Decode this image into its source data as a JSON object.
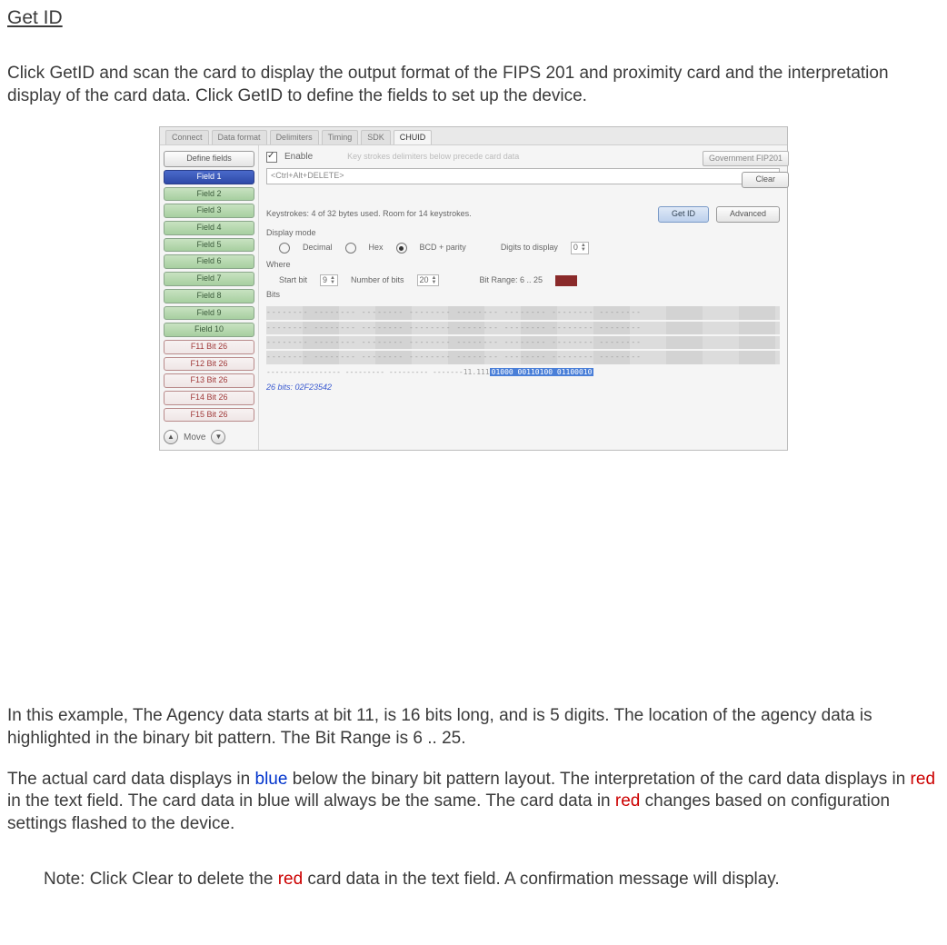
{
  "heading": "Get ID",
  "intro": "Click GetID and scan the card to display the output format of the FIPS 201 and proximity card and the interpretation display of the card data. Click GetID to define the fields to set up the device.",
  "para2_a": "In this example, The Agency data starts at bit 11, is 16 bits long, and is 5 digits. The location of the agency data is highlighted in the binary bit pattern. The Bit Range is 6 .. 25.",
  "para3_a": "The actual card data displays in ",
  "para3_blue": "blue",
  "para3_b": " below the binary bit pattern layout. The interpretation of the card data displays in ",
  "para3_red1": "red",
  "para3_c": " in the text field. The card data in blue will always be the same. The card data in ",
  "para3_red2": "red",
  "para3_d": " changes based on configuration settings flashed to the device.",
  "note_a": "Note: Click Clear to delete the ",
  "note_red": "red",
  "note_b": " card data in the text field. A confirmation message will display.",
  "shot": {
    "tabs": [
      "Connect",
      "Data format",
      "Delimiters",
      "Timing",
      "SDK",
      "CHUID"
    ],
    "define": "Define fields",
    "fields_green": [
      "Field 1",
      "Field 2",
      "Field 3",
      "Field 4",
      "Field 5",
      "Field 6",
      "Field 7",
      "Field 8",
      "Field 9",
      "Field 10"
    ],
    "fields_red": [
      "F11 Bit 26",
      "F12 Bit 26",
      "F13 Bit 26",
      "F14 Bit 26",
      "F15 Bit 26"
    ],
    "move": "Move",
    "enable": "Enable",
    "keyhint": "Key strokes delimiters below precede card data",
    "txtbox": "<Ctrl+Alt+DELETE>",
    "hangtab": "Government FIP201",
    "clear": "Clear",
    "kinfo": "Keystrokes: 4 of 32 bytes used. Room for 14 keystrokes.",
    "getid": "Get ID",
    "advanced": "Advanced",
    "displaymode": "Display mode",
    "decimal": "Decimal",
    "hex": "Hex",
    "bcd": "BCD + parity",
    "digits_lbl": "Digits to display",
    "digits_val": "0",
    "where": "Where",
    "startbit_lbl": "Start bit",
    "startbit_val": "9",
    "numbits_lbl": "Number of bits",
    "numbits_val": "20",
    "bitrange": "Bit Range: 6 .. 25",
    "bits_lbl": "Bits",
    "footnote": "26 bits: 02F23542",
    "lastdata": "----------------- --------- --------- -------11.111",
    "hl": "01000 00110100 01100010"
  }
}
